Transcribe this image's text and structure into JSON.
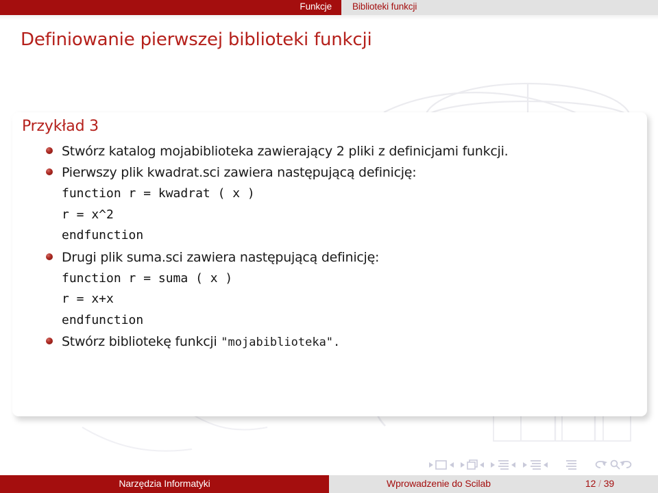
{
  "header": {
    "section": "Funkcje",
    "subsection": "Biblioteki funkcji",
    "red_color": "#a40e0e",
    "gray_color": "#e2e2e2"
  },
  "frame_title": "Definiowanie pierwszej biblioteki funkcji",
  "block": {
    "title": "Przykład 3",
    "items": [
      {
        "kind": "item",
        "segments": [
          {
            "text": "Stwórz katalog mojabiblioteka zawierający 2 pliki z definicjami funkcji.",
            "mono": false
          }
        ]
      },
      {
        "kind": "item",
        "segments": [
          {
            "text": "Pierwszy plik kwadrat.sci zawiera następującą definicję:",
            "mono": false
          }
        ]
      },
      {
        "kind": "code",
        "text": "function r = kwadrat ( x )"
      },
      {
        "kind": "code",
        "text": "r = x^2"
      },
      {
        "kind": "code",
        "text": "endfunction"
      },
      {
        "kind": "item",
        "segments": [
          {
            "text": "Drugi plik suma.sci zawiera następującą definicję:",
            "mono": false
          }
        ]
      },
      {
        "kind": "code",
        "text": "function r = suma ( x )"
      },
      {
        "kind": "code",
        "text": "r = x+x"
      },
      {
        "kind": "code",
        "text": "endfunction"
      },
      {
        "kind": "item",
        "segments": [
          {
            "text": "Stwórz bibliotekę funkcji ",
            "mono": false
          },
          {
            "text": "\"mojabiblioteka\".",
            "mono": true
          }
        ]
      }
    ]
  },
  "navigation": {
    "icons": [
      "prev-slide-arrow-icon",
      "slide-icon",
      "next-slide-arrow-icon",
      "prev-frame-arrow-icon",
      "frames-icon",
      "next-frame-arrow-icon",
      "prev-subsection-arrow-icon",
      "subsection-icon",
      "next-subsection-arrow-icon",
      "prev-section-arrow-icon",
      "section-icon",
      "next-section-arrow-icon",
      "presentation-icon",
      "back-arrow-icon",
      "search-icon",
      "forward-arrow-icon"
    ],
    "color": "#c9c9de"
  },
  "footer": {
    "author": "Narzędzia Informatyki",
    "title": "Wprowadzenie do Scilab",
    "page_current": "12",
    "page_separator": "/",
    "page_total": "39"
  }
}
